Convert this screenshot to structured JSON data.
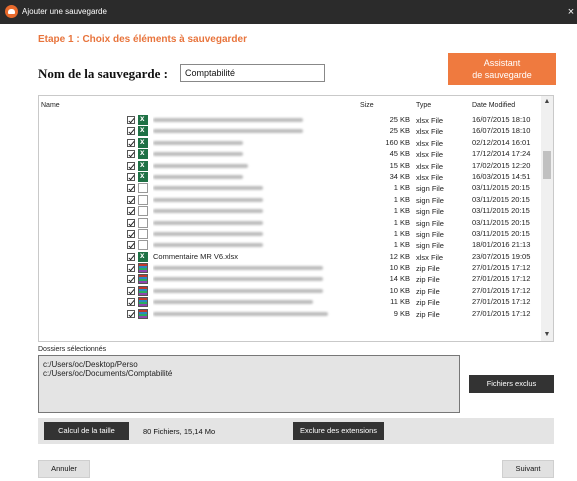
{
  "window": {
    "title": "Ajouter une sauvegarde",
    "close_label": "×",
    "accent": "#ef7a3f"
  },
  "step_title": "Etape 1 :   Choix des éléments à sauvegarder",
  "backup_name": {
    "label": "Nom de la sauvegarde :",
    "value": "Comptabilité"
  },
  "assistant_button": {
    "line1": "Assistant",
    "line2": "de sauvegarde"
  },
  "file_list": {
    "columns": {
      "name": "Name",
      "size": "Size",
      "type": "Type",
      "date": "Date Modified"
    },
    "rows": [
      {
        "icon": "xlsx",
        "size": "25 KB",
        "type": "xlsx File",
        "date": "16/07/2015 18:10",
        "checked": true
      },
      {
        "icon": "xlsx",
        "size": "25 KB",
        "type": "xlsx File",
        "date": "16/07/2015 18:10",
        "checked": true
      },
      {
        "icon": "xlsx",
        "size": "160 KB",
        "type": "xlsx File",
        "date": "02/12/2014 16:01",
        "checked": true
      },
      {
        "icon": "xlsx",
        "size": "45 KB",
        "type": "xlsx File",
        "date": "17/12/2014 17:24",
        "checked": true
      },
      {
        "icon": "xlsx",
        "size": "15 KB",
        "type": "xlsx File",
        "date": "17/02/2015 12:20",
        "checked": true
      },
      {
        "icon": "xlsx",
        "size": "34 KB",
        "type": "xlsx File",
        "date": "16/03/2015 14:51",
        "checked": true
      },
      {
        "icon": "sign",
        "size": "1 KB",
        "type": "sign File",
        "date": "03/11/2015 20:15",
        "checked": true
      },
      {
        "icon": "sign",
        "size": "1 KB",
        "type": "sign File",
        "date": "03/11/2015 20:15",
        "checked": true
      },
      {
        "icon": "sign",
        "size": "1 KB",
        "type": "sign File",
        "date": "03/11/2015 20:15",
        "checked": true
      },
      {
        "icon": "sign",
        "size": "1 KB",
        "type": "sign File",
        "date": "03/11/2015 20:15",
        "checked": true
      },
      {
        "icon": "sign",
        "size": "1 KB",
        "type": "sign File",
        "date": "03/11/2015 20:15",
        "checked": true
      },
      {
        "icon": "sign",
        "size": "1 KB",
        "type": "sign File",
        "date": "18/01/2016 21:13",
        "checked": true
      },
      {
        "icon": "xlsx",
        "name": "Commentaire MR V6.xlsx",
        "size": "12 KB",
        "type": "xlsx File",
        "date": "23/07/2015 19:05",
        "checked": true
      },
      {
        "icon": "zip",
        "size": "10 KB",
        "type": "zip File",
        "date": "27/01/2015 17:12",
        "checked": true
      },
      {
        "icon": "zip",
        "size": "14 KB",
        "type": "zip File",
        "date": "27/01/2015 17:12",
        "checked": true
      },
      {
        "icon": "zip",
        "size": "10 KB",
        "type": "zip File",
        "date": "27/01/2015 17:12",
        "checked": true
      },
      {
        "icon": "zip",
        "size": "11 KB",
        "type": "zip File",
        "date": "27/01/2015 17:12",
        "checked": true
      },
      {
        "icon": "zip",
        "size": "9 KB",
        "type": "zip File",
        "date": "27/01/2015 17:12",
        "checked": true
      }
    ]
  },
  "folders": {
    "label": "Dossiers sélectionnés",
    "paths": [
      "c:/Users/oc/Desktop/Perso",
      "c:/Users/oc/Documents/Comptabilité"
    ]
  },
  "buttons": {
    "excluded_files": "Fichiers exclus",
    "calc_size": "Calcul de la taille",
    "exclude_extensions": "Exclure des extensions",
    "cancel": "Annuler",
    "next": "Suivant"
  },
  "summary": "80 Fichiers, 15,14 Mo"
}
